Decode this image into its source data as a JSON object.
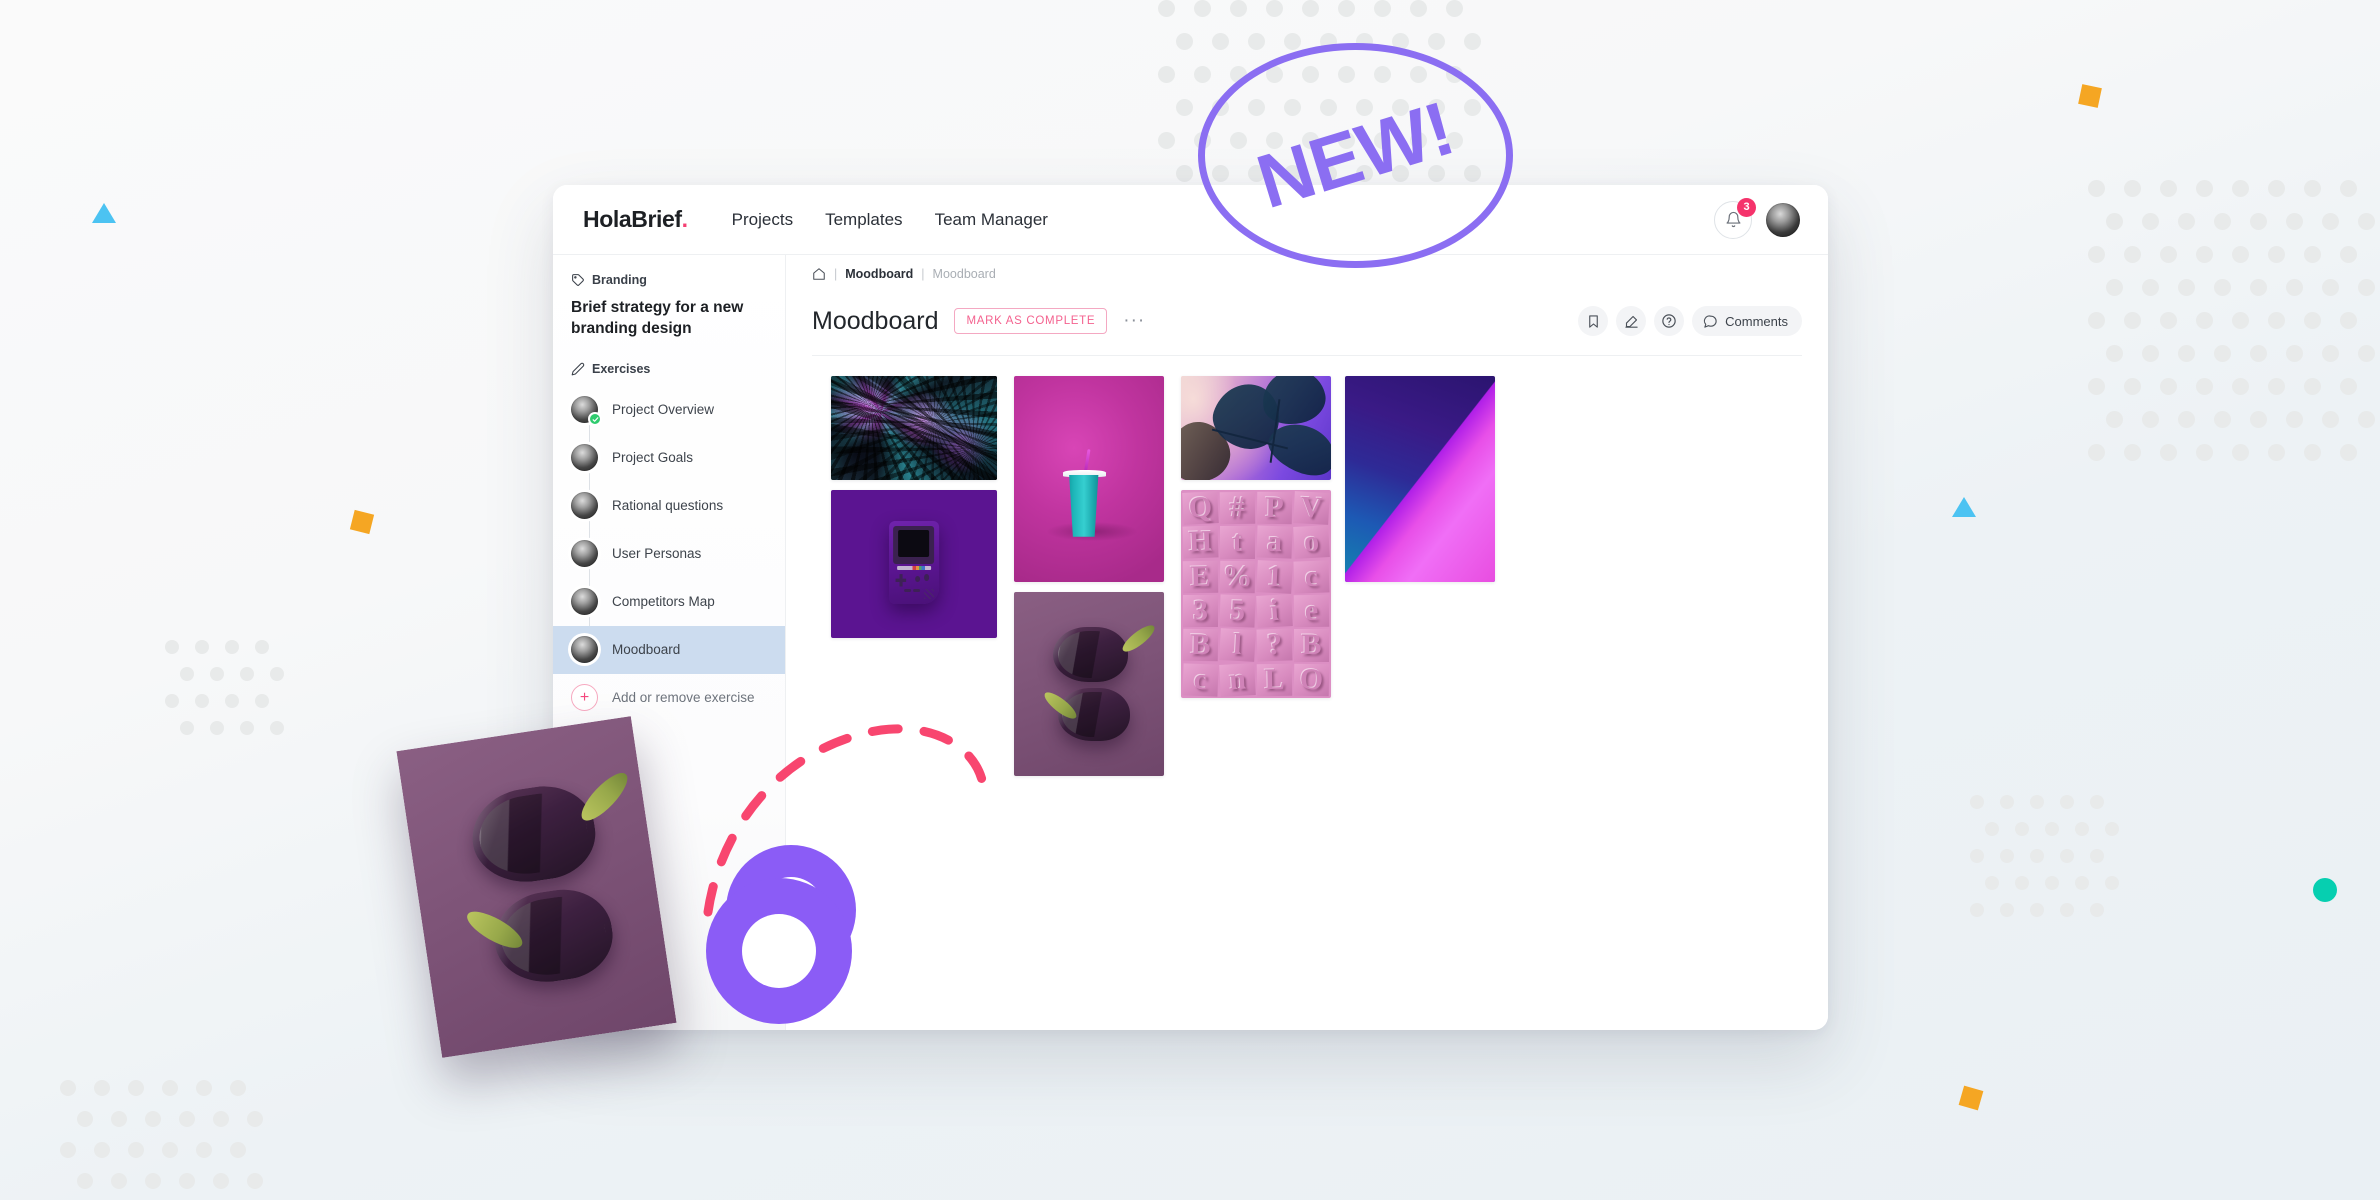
{
  "app": {
    "brand_name": "HolaBrief",
    "brand_dot": "."
  },
  "nav": {
    "items": [
      {
        "label": "Projects"
      },
      {
        "label": "Templates"
      },
      {
        "label": "Team Manager"
      }
    ]
  },
  "topbar_right": {
    "notification_count": "3",
    "bell_icon": "bell-icon",
    "avatar_icon": "user-avatar"
  },
  "sidebar": {
    "tag_icon": "tag-icon",
    "tag_label": "Branding",
    "project_title": "Brief strategy for a new branding design",
    "section_icon": "pencil-icon",
    "section_label": "Exercises",
    "exercises": [
      {
        "label": "Project Overview",
        "complete": true,
        "active": false
      },
      {
        "label": "Project Goals",
        "complete": false,
        "active": false
      },
      {
        "label": "Rational questions",
        "complete": false,
        "active": false
      },
      {
        "label": "User Personas",
        "complete": false,
        "active": false
      },
      {
        "label": "Competitors Map",
        "complete": false,
        "active": false
      },
      {
        "label": "Moodboard",
        "complete": false,
        "active": true
      }
    ],
    "add_label": "Add or remove exercise",
    "add_icon": "plus-circle-icon"
  },
  "breadcrumb": {
    "home_icon": "home-icon",
    "sep": "|",
    "parent": "Moodboard",
    "current": "Moodboard"
  },
  "page": {
    "title": "Moodboard",
    "mark_complete_label": "MARK AS COMPLETE",
    "more_label": "···"
  },
  "page_actions": {
    "bookmark_icon": "bookmark-icon",
    "edit_icon": "edit-pencil-icon",
    "help_icon": "help-circle-icon",
    "comments_icon": "comment-bubble-icon",
    "comments_label": "Comments"
  },
  "moodboard": {
    "tiles": [
      {
        "name": "tropical-palms",
        "alt": "Neon magenta and teal palm leaves"
      },
      {
        "name": "purple-gameboy",
        "alt": "Purple handheld game console on purple background"
      },
      {
        "name": "teal-cup",
        "alt": "Teal drinking cup with purple straw on magenta background"
      },
      {
        "name": "monstera-neon",
        "alt": "Monstera leaves under purple neon light"
      },
      {
        "name": "pink-typography",
        "alt": "Pink embossed letterpress type blocks"
      },
      {
        "name": "gradient-corner",
        "alt": "Blue to magenta gradient corner"
      },
      {
        "name": "purple-peppers",
        "alt": "Two dark purple bell peppers on mauve background"
      }
    ],
    "type_glyphs": [
      "Q",
      "#",
      "P",
      "V",
      "H",
      "t",
      "a",
      "o",
      "E",
      "%",
      "1",
      "c",
      "3",
      "5",
      "i",
      "e",
      "B",
      "l",
      "?",
      "B",
      "c",
      "n",
      "L",
      "O"
    ]
  },
  "drag": {
    "card_name": "purple-peppers",
    "card_alt": "Two dark purple bell peppers on mauve background",
    "cursor_icon": "drag-cursor-ring",
    "path_icon": "dashed-drag-path"
  },
  "annotation": {
    "new_badge_label": "NEW!"
  },
  "colors": {
    "brand_accent": "#f53f72",
    "highlight_purple": "#8b6ef2",
    "active_item": "#ccdcef",
    "complete_green": "#2fcb6e",
    "path_pink": "#f8466f",
    "deco_cyan": "#4cc3f2",
    "deco_orange": "#f5a623",
    "deco_teal": "#06cfb0",
    "deco_dot": "#e8eaea"
  }
}
